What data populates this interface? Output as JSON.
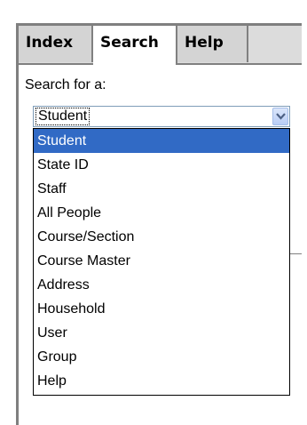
{
  "tabs": [
    {
      "label": "Index"
    },
    {
      "label": "Search"
    },
    {
      "label": "Help"
    }
  ],
  "search": {
    "label": "Search for a:",
    "selected_value": "Student",
    "options": [
      "Student",
      "State ID",
      "Staff",
      "All People",
      "Course/Section",
      "Course Master",
      "Address",
      "Household",
      "User",
      "Group",
      "Help"
    ]
  },
  "colors": {
    "selection": "#316ac5",
    "tab_background": "#d4d4d4"
  }
}
